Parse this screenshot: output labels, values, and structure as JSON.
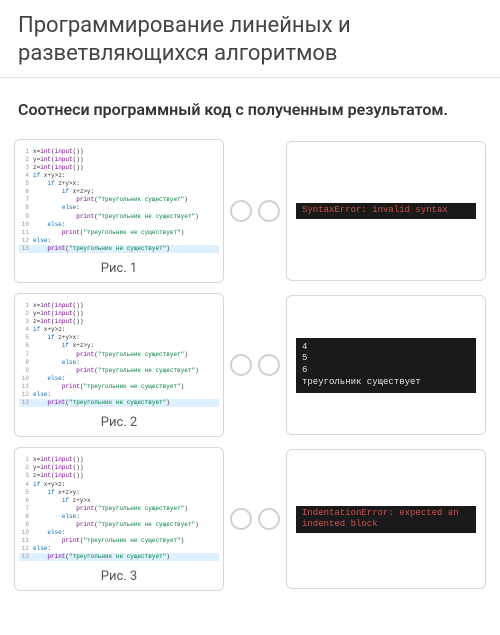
{
  "title": "Программирование линейных и разветвляющихся алгоритмов",
  "instruction": "Соотнеси программный код с полученным результатом.",
  "figs": [
    {
      "caption": "Рис. 1",
      "code": [
        {
          "n": "1",
          "cls": "",
          "html": "x=<span class='fn'>int</span>(<span class='fn'>input</span>())"
        },
        {
          "n": "2",
          "cls": "",
          "html": "y=<span class='fn'>int</span>(<span class='fn'>input</span>())"
        },
        {
          "n": "3",
          "cls": "",
          "html": "z=<span class='fn'>int</span>(<span class='fn'>input</span>())"
        },
        {
          "n": "4",
          "cls": "",
          "html": "<span class='kw'>if</span> x+y&gt;z:"
        },
        {
          "n": "5",
          "cls": "",
          "html": "    <span class='kw'>if</span> z+y&gt;x:"
        },
        {
          "n": "6",
          "cls": "",
          "html": "        <span class='kw'>if</span> x+z&gt;y:"
        },
        {
          "n": "7",
          "cls": "",
          "html": "            <span class='fn'>print</span>(<span class='str'>\"треугольник существует\"</span>)"
        },
        {
          "n": "8",
          "cls": "",
          "html": "        <span class='kw'>else</span>:"
        },
        {
          "n": "9",
          "cls": "",
          "html": "            <span class='fn'>print</span>(<span class='str'>\"треугольник не существует\"</span>)"
        },
        {
          "n": "10",
          "cls": "",
          "html": "    <span class='kw'>else</span>:"
        },
        {
          "n": "11",
          "cls": "",
          "html": "        <span class='fn'>print</span>(<span class='str'>\"треугольник не существует\"</span>)"
        },
        {
          "n": "12",
          "cls": "",
          "html": "<span class='kw'>else</span>:"
        },
        {
          "n": "13",
          "cls": "hl",
          "html": "    <span class='fn'>print</span>(<span class='str'>\"треугольник не существует\"</span>)"
        }
      ]
    },
    {
      "caption": "Рис. 2",
      "code": [
        {
          "n": "1",
          "cls": "",
          "html": "x=<span class='fn'>int</span>(<span class='fn'>input</span>())"
        },
        {
          "n": "2",
          "cls": "",
          "html": "y=<span class='fn'>int</span>(<span class='fn'>input</span>())"
        },
        {
          "n": "3",
          "cls": "",
          "html": "z=<span class='fn'>int</span>(<span class='fn'>input</span>())"
        },
        {
          "n": "4",
          "cls": "",
          "html": "<span class='kw'>if</span> x+y&gt;z:"
        },
        {
          "n": "5",
          "cls": "",
          "html": "    <span class='kw'>if</span> z+y&gt;x:"
        },
        {
          "n": "6",
          "cls": "",
          "html": "        <span class='kw'>if</span> x+z&gt;y:"
        },
        {
          "n": "7",
          "cls": "",
          "html": "            <span class='fn'>print</span>(<span class='str'>\"треугольник существует\"</span>)"
        },
        {
          "n": "8",
          "cls": "",
          "html": "        <span class='kw'>else</span>:"
        },
        {
          "n": "9",
          "cls": "",
          "html": "            <span class='fn'>print</span>(<span class='str'>\"треугольник не существует\"</span>)"
        },
        {
          "n": "10",
          "cls": "",
          "html": "    <span class='kw'>else</span>:"
        },
        {
          "n": "11",
          "cls": "",
          "html": "        <span class='fn'>print</span>(<span class='str'>\"треугольник не существует\"</span>)"
        },
        {
          "n": "12",
          "cls": "",
          "html": "<span class='kw'>else</span>:"
        },
        {
          "n": "13",
          "cls": "hl",
          "html": "    <span class='fn'>print</span>(<span class='str'>\"треугольник не существует\"</span>)"
        }
      ]
    },
    {
      "caption": "Рис. 3",
      "code": [
        {
          "n": "1",
          "cls": "",
          "html": "x=<span class='fn'>int</span>(<span class='fn'>input</span>())"
        },
        {
          "n": "2",
          "cls": "",
          "html": "y=<span class='fn'>int</span>(<span class='fn'>input</span>())"
        },
        {
          "n": "3",
          "cls": "",
          "html": "z=<span class='fn'>int</span>(<span class='fn'>input</span>())"
        },
        {
          "n": "4",
          "cls": "",
          "html": "<span class='kw'>if</span> x+y&gt;z:"
        },
        {
          "n": "5",
          "cls": "",
          "html": "    <span class='kw'>if</span> x+z&gt;y:"
        },
        {
          "n": "6",
          "cls": "",
          "html": "        <span class='kw'>if</span> z+y&gt;x"
        },
        {
          "n": "7",
          "cls": "",
          "html": "            <span class='fn'>print</span>(<span class='str'>\"треугольник существует\"</span>)"
        },
        {
          "n": "8",
          "cls": "",
          "html": "        <span class='kw'>else</span>:"
        },
        {
          "n": "9",
          "cls": "",
          "html": "            <span class='fn'>print</span>(<span class='str'>\"треугольник не существует\"</span>)"
        },
        {
          "n": "10",
          "cls": "",
          "html": "    <span class='kw'>else</span>:"
        },
        {
          "n": "11",
          "cls": "",
          "html": "        <span class='fn'>print</span>(<span class='str'>\"треугольник не существует\"</span>)"
        },
        {
          "n": "12",
          "cls": "",
          "html": "<span class='kw'>else</span>:"
        },
        {
          "n": "13",
          "cls": "hl",
          "html": "    <span class='fn'>print</span>(<span class='str'>\"треугольник не существует\"</span>)"
        }
      ]
    }
  ],
  "outputs": [
    {
      "kind": "thin",
      "lines": [
        {
          "cls": "err",
          "text": "SyntaxError: invalid syntax"
        }
      ]
    },
    {
      "kind": "tall",
      "lines": [
        {
          "cls": "ok",
          "text": "4"
        },
        {
          "cls": "ok",
          "text": "5"
        },
        {
          "cls": "ok",
          "text": "6"
        },
        {
          "cls": "ok",
          "text": "треугольник существует"
        }
      ]
    },
    {
      "kind": "thin",
      "lines": [
        {
          "cls": "err",
          "text": "IndentationError: expected an indented block"
        }
      ]
    }
  ]
}
